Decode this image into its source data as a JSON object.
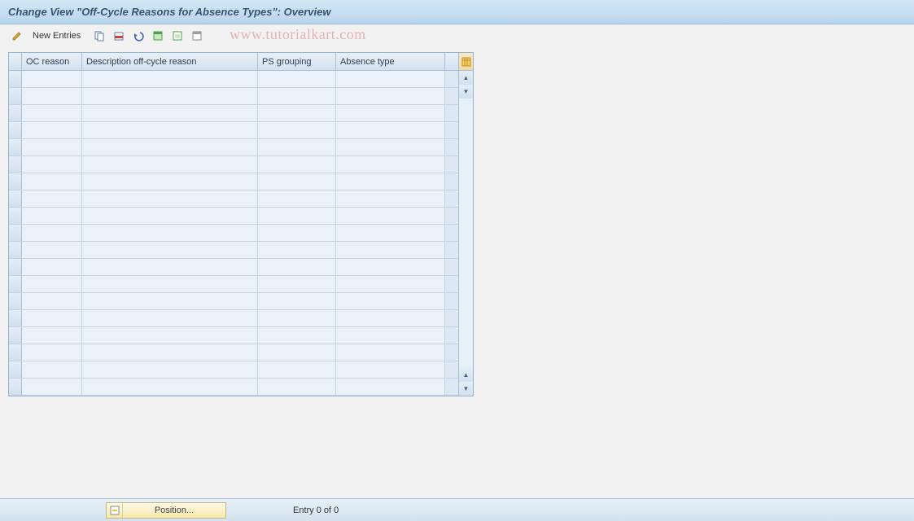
{
  "title": "Change View \"Off-Cycle Reasons for Absence Types\": Overview",
  "toolbar": {
    "new_entries_label": "New Entries"
  },
  "watermark": "www.tutorialkart.com",
  "table": {
    "columns": [
      "OC reason",
      "Description off-cycle reason",
      "PS grouping",
      "Absence type"
    ],
    "row_count": 19
  },
  "footer": {
    "position_label": "Position...",
    "entry_status": "Entry 0 of 0"
  }
}
